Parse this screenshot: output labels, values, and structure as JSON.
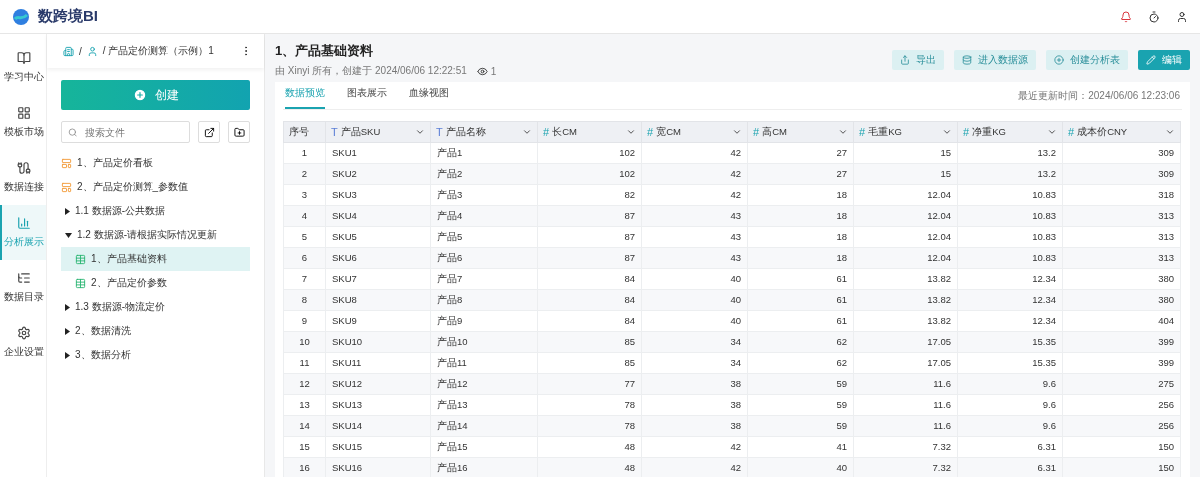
{
  "app": {
    "name": "数跨境BI"
  },
  "rail": [
    {
      "label": "学习中心",
      "selected": false
    },
    {
      "label": "模板市场",
      "selected": false
    },
    {
      "label": "数据连接",
      "selected": false
    },
    {
      "label": "分析展示",
      "selected": true
    },
    {
      "label": "数据目录",
      "selected": false
    },
    {
      "label": "企业设置",
      "selected": false
    }
  ],
  "breadcrumb": {
    "separator": "/",
    "current": "/ 产品定价测算（示例）1"
  },
  "create_button": "创建",
  "search": {
    "placeholder": "搜索文件"
  },
  "tree": [
    {
      "label": "1、产品定价看板",
      "kind": "board",
      "selected": false
    },
    {
      "label": "2、产品定价测算_参数值",
      "kind": "board",
      "selected": false
    },
    {
      "label": "1.1 数据源-公共数据",
      "kind": "folder",
      "expanded": false,
      "selected": false
    },
    {
      "label": "1.2 数据源-请根据实际情况更新",
      "kind": "folder",
      "expanded": true,
      "selected": false,
      "children": [
        {
          "label": "1、产品基础资料",
          "kind": "table",
          "selected": true
        },
        {
          "label": "2、产品定价参数",
          "kind": "table",
          "selected": false
        }
      ]
    },
    {
      "label": "1.3 数据源-物流定价",
      "kind": "folder",
      "expanded": false,
      "selected": false
    },
    {
      "label": "2、数据清洗",
      "kind": "folder",
      "expanded": false,
      "selected": false
    },
    {
      "label": "3、数据分析",
      "kind": "folder",
      "expanded": false,
      "selected": false
    }
  ],
  "page": {
    "title": "1、产品基础资料",
    "meta": "由 Xinyi 所有，创建于 2024/06/06 12:22:51",
    "views": "1"
  },
  "actions": [
    {
      "label": "导出",
      "kind": "secondary"
    },
    {
      "label": "进入数据源",
      "kind": "secondary"
    },
    {
      "label": "创建分析表",
      "kind": "secondary"
    },
    {
      "label": "编辑",
      "kind": "primary"
    }
  ],
  "tabs": [
    {
      "label": "数据预览",
      "selected": true
    },
    {
      "label": "图表展示",
      "selected": false
    },
    {
      "label": "血缘视图",
      "selected": false
    }
  ],
  "updated": "最近更新时间：2024/06/06 12:23:06",
  "table": {
    "columns": [
      {
        "label": "序号",
        "kind": "index"
      },
      {
        "label": "产品SKU",
        "kind": "text",
        "type_mark": "T"
      },
      {
        "label": "产品名称",
        "kind": "text",
        "type_mark": "T"
      },
      {
        "label": "长CM",
        "kind": "number",
        "type_mark": "#"
      },
      {
        "label": "宽CM",
        "kind": "number",
        "type_mark": "#"
      },
      {
        "label": "高CM",
        "kind": "number",
        "type_mark": "#"
      },
      {
        "label": "毛重KG",
        "kind": "number",
        "type_mark": "#"
      },
      {
        "label": "净重KG",
        "kind": "number",
        "type_mark": "#"
      },
      {
        "label": "成本价CNY",
        "kind": "number",
        "type_mark": "#"
      }
    ],
    "rows": [
      [
        "1",
        "SKU1",
        "产品1",
        "102",
        "42",
        "27",
        "15",
        "13.2",
        "309"
      ],
      [
        "2",
        "SKU2",
        "产品2",
        "102",
        "42",
        "27",
        "15",
        "13.2",
        "309"
      ],
      [
        "3",
        "SKU3",
        "产品3",
        "82",
        "42",
        "18",
        "12.04",
        "10.83",
        "318"
      ],
      [
        "4",
        "SKU4",
        "产品4",
        "87",
        "43",
        "18",
        "12.04",
        "10.83",
        "313"
      ],
      [
        "5",
        "SKU5",
        "产品5",
        "87",
        "43",
        "18",
        "12.04",
        "10.83",
        "313"
      ],
      [
        "6",
        "SKU6",
        "产品6",
        "87",
        "43",
        "18",
        "12.04",
        "10.83",
        "313"
      ],
      [
        "7",
        "SKU7",
        "产品7",
        "84",
        "40",
        "61",
        "13.82",
        "12.34",
        "380"
      ],
      [
        "8",
        "SKU8",
        "产品8",
        "84",
        "40",
        "61",
        "13.82",
        "12.34",
        "380"
      ],
      [
        "9",
        "SKU9",
        "产品9",
        "84",
        "40",
        "61",
        "13.82",
        "12.34",
        "404"
      ],
      [
        "10",
        "SKU10",
        "产品10",
        "85",
        "34",
        "62",
        "17.05",
        "15.35",
        "399"
      ],
      [
        "11",
        "SKU11",
        "产品11",
        "85",
        "34",
        "62",
        "17.05",
        "15.35",
        "399"
      ],
      [
        "12",
        "SKU12",
        "产品12",
        "77",
        "38",
        "59",
        "11.6",
        "9.6",
        "275"
      ],
      [
        "13",
        "SKU13",
        "产品13",
        "78",
        "38",
        "59",
        "11.6",
        "9.6",
        "256"
      ],
      [
        "14",
        "SKU14",
        "产品14",
        "78",
        "38",
        "59",
        "11.6",
        "9.6",
        "256"
      ],
      [
        "15",
        "SKU15",
        "产品15",
        "48",
        "42",
        "41",
        "7.32",
        "6.31",
        "150"
      ],
      [
        "16",
        "SKU16",
        "产品16",
        "48",
        "42",
        "40",
        "7.32",
        "6.31",
        "150"
      ]
    ]
  }
}
